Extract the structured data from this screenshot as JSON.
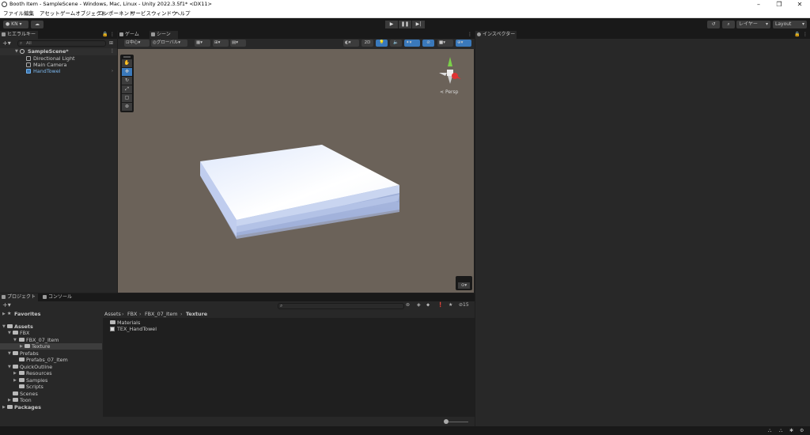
{
  "window": {
    "title": "Booth Item - SampleScene - Windows, Mac, Linux - Unity 2022.3.5f1* <DX11>"
  },
  "menu": [
    "ファイル",
    "編集",
    "アセット",
    "ゲームオブジェクト",
    "コンポーネント",
    "サービス",
    "ウィンドウ",
    "ヘルプ"
  ],
  "toolbar": {
    "account": "KN",
    "layers": "レイヤー",
    "layout": "Layout"
  },
  "hierarchy": {
    "tab": "ヒエラルキー",
    "search_placeholder": "All",
    "scene": "SampleScene*",
    "items": [
      "Directional Light",
      "Main Camera",
      "HandTowel"
    ]
  },
  "scene_view": {
    "tabs": [
      "ゲーム",
      "シーン"
    ],
    "pivot": "中心",
    "space": "グローバル",
    "mode2d": "2D",
    "persp": "Persp"
  },
  "inspector": {
    "tab": "インスペクター"
  },
  "project": {
    "tabs": [
      "プロジェクト",
      "コンソール"
    ],
    "favorites": "Favorites",
    "assets_root": "Assets",
    "tree": [
      {
        "label": "FBX"
      },
      {
        "label": "FBX_07_Item"
      },
      {
        "label": "Texture"
      },
      {
        "label": "Prefabs"
      },
      {
        "label": "Prefabs_07_Item"
      },
      {
        "label": "QuickOutline"
      },
      {
        "label": "Resources"
      },
      {
        "label": "Samples"
      },
      {
        "label": "Scripts"
      },
      {
        "label": "Scenes"
      },
      {
        "label": "Toon"
      }
    ],
    "packages": "Packages",
    "breadcrumb": [
      "Assets",
      "FBX",
      "FBX_07_Item",
      "Texture"
    ],
    "files": [
      "Materials",
      "TEX_HandTowel"
    ],
    "hidden_count": "15"
  },
  "colors": {
    "accent": "#3a79bb",
    "scene_bg": "#6b6259",
    "selected": "#2c5d87"
  }
}
